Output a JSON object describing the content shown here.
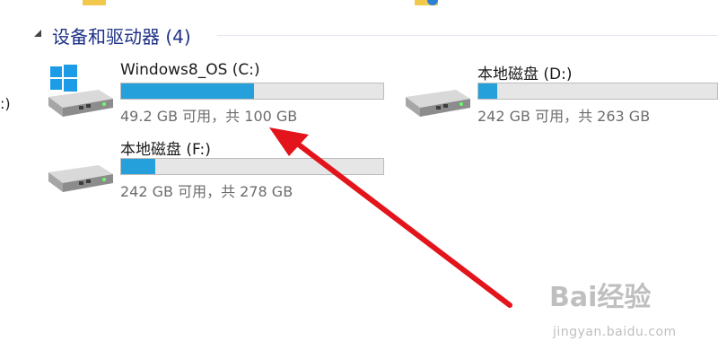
{
  "group": {
    "title": "设备和驱动器 (4)"
  },
  "drives": [
    {
      "name": "Windows8_OS (C:)",
      "space_text": "49.2 GB 可用，共 100 GB",
      "used_fraction": 0.508,
      "icon": "windows-system-drive-icon"
    },
    {
      "name": "本地磁盘 (D:)",
      "space_text": "242 GB 可用，共 263 GB",
      "used_fraction": 0.08,
      "icon": "hard-drive-icon"
    },
    {
      "name": "本地磁盘 (F:)",
      "space_text": "242 GB 可用，共 278 GB",
      "used_fraction": 0.13,
      "icon": "hard-drive-icon"
    }
  ],
  "left_edge_text": ":)",
  "watermark": {
    "logo": "Bai经验",
    "site": "jingyan.baidu.com"
  },
  "colors": {
    "group_title": "#1e3287",
    "usage_bar": "#26a0da",
    "annotation_arrow": "#e3141b"
  }
}
